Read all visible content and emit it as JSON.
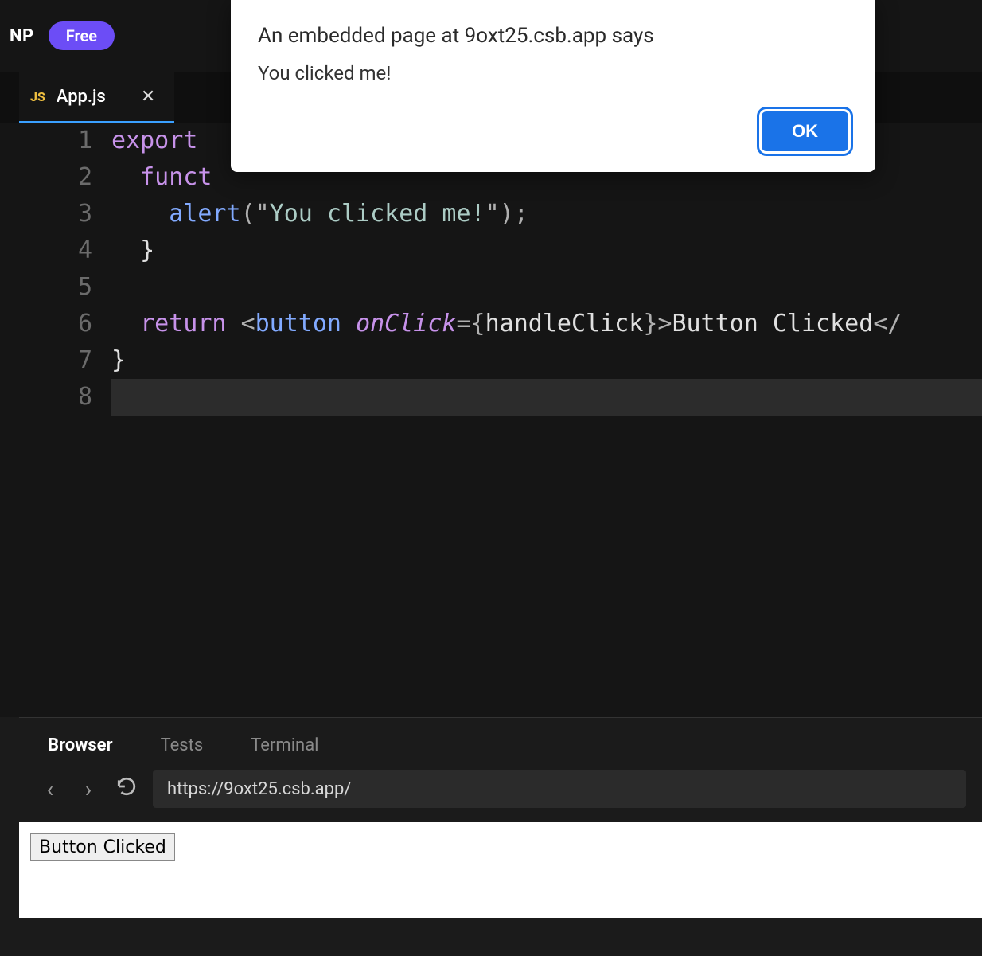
{
  "header": {
    "badge": "NP",
    "plan_label": "Free"
  },
  "tab": {
    "icon_label": "JS",
    "filename": "App.js",
    "close_glyph": "✕"
  },
  "editor": {
    "line_numbers": [
      "1",
      "2",
      "3",
      "4",
      "5",
      "6",
      "7",
      "8"
    ],
    "code_tokens": {
      "l1_export": "export ",
      "l2_funct": "funct",
      "l3_alert": "alert",
      "l3_open": "(",
      "l3_q1": "\"",
      "l3_str": "You clicked me!",
      "l3_q2": "\"",
      "l3_close": ");",
      "l4_brace": "}",
      "l6_return": "return ",
      "l6_lt": "<",
      "l6_tag1": "button ",
      "l6_attr": "onClick",
      "l6_eq": "={",
      "l6_handler": "handleClick",
      "l6_rb": "}>",
      "l6_text": "Button Clicked",
      "l6_close": "</",
      "l7_brace": "}"
    }
  },
  "panel": {
    "tabs": {
      "browser": "Browser",
      "tests": "Tests",
      "terminal": "Terminal"
    },
    "nav": {
      "back": "‹",
      "forward": "›"
    },
    "url": "https://9oxt25.csb.app/",
    "preview_button_label": "Button Clicked"
  },
  "dialog": {
    "title": "An embedded page at 9oxt25.csb.app says",
    "message": "You clicked me!",
    "ok_label": "OK"
  }
}
